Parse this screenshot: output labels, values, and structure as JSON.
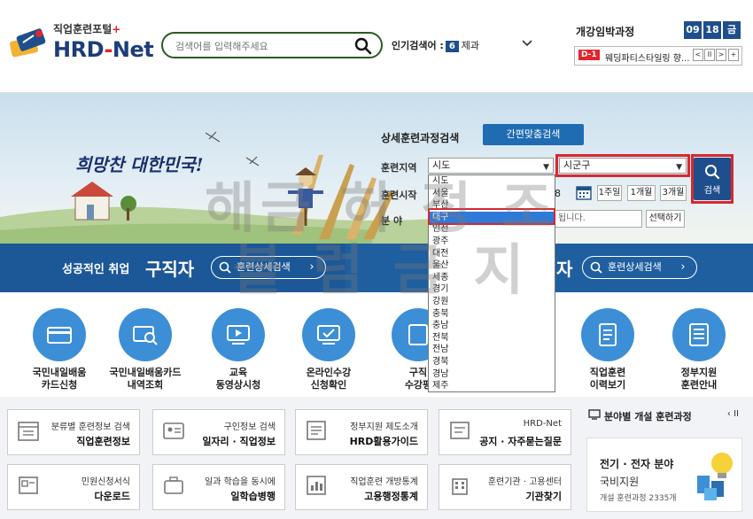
{
  "header": {
    "logo_sub": "직업훈련포털",
    "logo_plus": "+",
    "logo_main_a": "HRD",
    "logo_main_dash": "-",
    "logo_main_b": "Net",
    "search_placeholder": "검색어를 입력해주세요",
    "popular_label": "인기검색어 :",
    "popular_rank": "6",
    "popular_keyword": "제과",
    "open_title": "개강임박과정",
    "date_month": "09",
    "date_day": "18",
    "date_weekday": "금",
    "open_dday": "D-1",
    "open_course": "웨딩파티스타일링 향...",
    "btn_prev": "<",
    "btn_pause": "II",
    "btn_next": ">",
    "btn_plus": "+"
  },
  "hero": {
    "slogan": "희망찬 대한민국!",
    "panel_title": "상세훈련과정검색",
    "quick_search": "간편맞춤검색",
    "label_region": "훈련지역",
    "label_start": "훈련시작",
    "label_field": "분   야",
    "region_select": "시도",
    "district_select": "시군구",
    "date_fragment": "8",
    "btn_1week": "1주일",
    "btn_1month": "1개월",
    "btn_3month": "3개월",
    "field_placeholder": "됩니다.",
    "btn_choose": "선택하기",
    "search_button": "검색"
  },
  "dropdown": {
    "items": [
      "시도",
      "서울",
      "부산",
      "대구",
      "인천",
      "광주",
      "대전",
      "울산",
      "세종",
      "경기",
      "강원",
      "충북",
      "충남",
      "전북",
      "전남",
      "경북",
      "경남",
      "제주"
    ],
    "selected_index": 3
  },
  "banner": {
    "left_prefix": "성공적인 취업",
    "left_big": "구직자",
    "left_pill": "훈련상세검색",
    "right_big": "자",
    "right_pill": "훈련상세검색"
  },
  "quick_icons": [
    {
      "label": "국민내일배움\n카드신청"
    },
    {
      "label": "국민내일배움카드\n내역조회"
    },
    {
      "label": "교육\n동영상시청"
    },
    {
      "label": "온라인수강\n신청확인"
    },
    {
      "label": "구직\n수강평"
    },
    {
      "label": "직업훈련\n이력보기"
    },
    {
      "label": "정부지원\n훈련안내"
    }
  ],
  "cards": [
    {
      "t1": "분류별 훈련정보 검색",
      "t2": "직업훈련정보"
    },
    {
      "t1": "구인정보 검색",
      "t2": "일자리 · 직업정보"
    },
    {
      "t1": "정부지원 제도소개",
      "t2": "HRD활용가이드"
    },
    {
      "t1": "HRD-Net",
      "t2": "공지 · 자주묻는질문"
    },
    {
      "t1": "민원신청서식",
      "t2": "다운로드"
    },
    {
      "t1": "일과 학습을 동시에",
      "t2": "일학습병행"
    },
    {
      "t1": "직업훈련 개방통계",
      "t2": "고용행정통계"
    },
    {
      "t1": "훈련기관 · 고용센터",
      "t2": "기관찾기"
    }
  ],
  "side": {
    "title": "분야별 개설 훈련과정",
    "nav_prev": "‹",
    "nav_pause": "II",
    "card_a": "전기 · 전자 분야",
    "card_b": "국비지원",
    "card_c": "개설 훈련과정 2335개"
  },
  "watermark": {
    "line1": "해금 허 정 조",
    "line2": "블 럼 금 지"
  },
  "colors": {
    "brand_navy": "#1c3d7a",
    "accent_red": "#d8282f",
    "banner_blue": "#1f5fa0",
    "icon_blue": "#3c8fd6"
  }
}
